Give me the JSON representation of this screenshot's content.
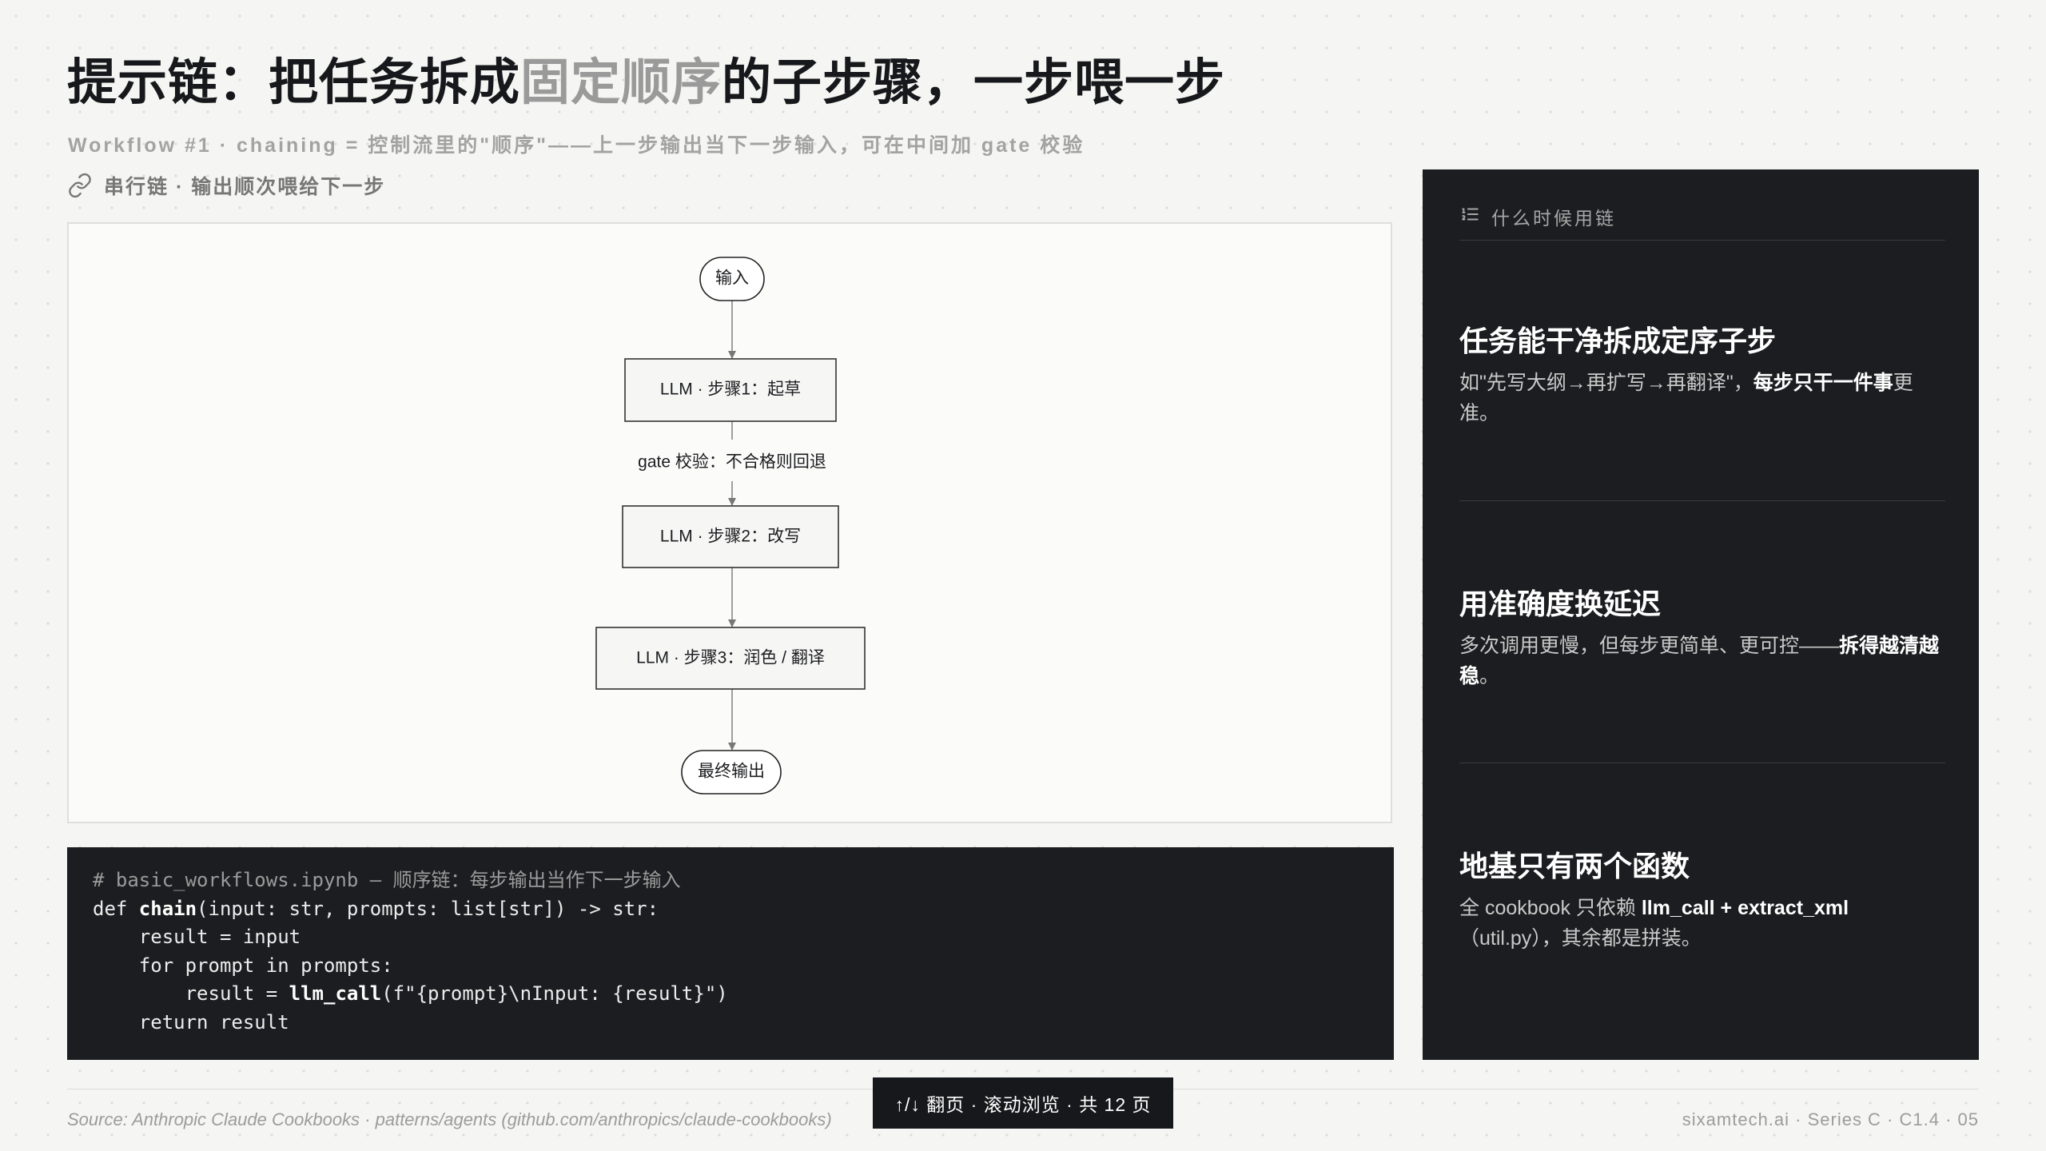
{
  "header": {
    "title_prefix": "提示链：把任务拆成",
    "title_highlight": "固定顺序",
    "title_suffix": "的子步骤，一步喂一步",
    "subtitle": "Workflow #1 · chaining = 控制流里的\"顺序\"——上一步输出当下一步输入，可在中间加 gate 校验"
  },
  "section": {
    "icon": "link-icon",
    "label": "串行链 · 输出顺次喂给下一步"
  },
  "flow": {
    "start": "输入",
    "step1": "LLM · 步骤1：起草",
    "gate": "gate 校验：不合格则回退",
    "step2": "LLM · 步骤2：改写",
    "step3": "LLM · 步骤3：润色 / 翻译",
    "end": "最终输出"
  },
  "code": {
    "comment": "# basic_workflows.ipynb — 顺序链：每步输出当作下一步输入",
    "line1_kw": "def ",
    "line1_fn": "chain",
    "line1_rest": "(input: str, prompts: list[str]) -> str:",
    "line2": "    result = input",
    "line3": "    for prompt in prompts:",
    "line4_indent": "        result = ",
    "line4_fn": "llm_call",
    "line4_rest": "(f\"{prompt}\\nInput: {result}\")",
    "line5": "    return result"
  },
  "panel": {
    "heading": "什么时候用链",
    "heading_icon": "list-icon",
    "items": [
      {
        "title": "任务能干净拆成定序子步",
        "desc_a": "如\"先写大纲→再扩写→再翻译\"，",
        "desc_b": "每步只干一件事",
        "desc_c": "更准。"
      },
      {
        "title": "用准确度换延迟",
        "desc_a": "多次调用更慢，但每步更简单、更可控——",
        "desc_b": "拆得越清越稳",
        "desc_c": "。"
      },
      {
        "title": "地基只有两个函数",
        "desc_a": "全 cookbook 只依赖 ",
        "desc_b": "llm_call + extract_xml",
        "desc_c": "（util.py），其余都是拼装。"
      }
    ]
  },
  "footer": {
    "source": "Source: Anthropic Claude Cookbooks · patterns/agents (github.com/anthropics/claude-cookbooks)",
    "brand": "sixamtech.ai · Series C · C1.4 · 05",
    "nav_hint": "↑/↓ 翻页 · 滚动浏览 · 共 12 页"
  }
}
